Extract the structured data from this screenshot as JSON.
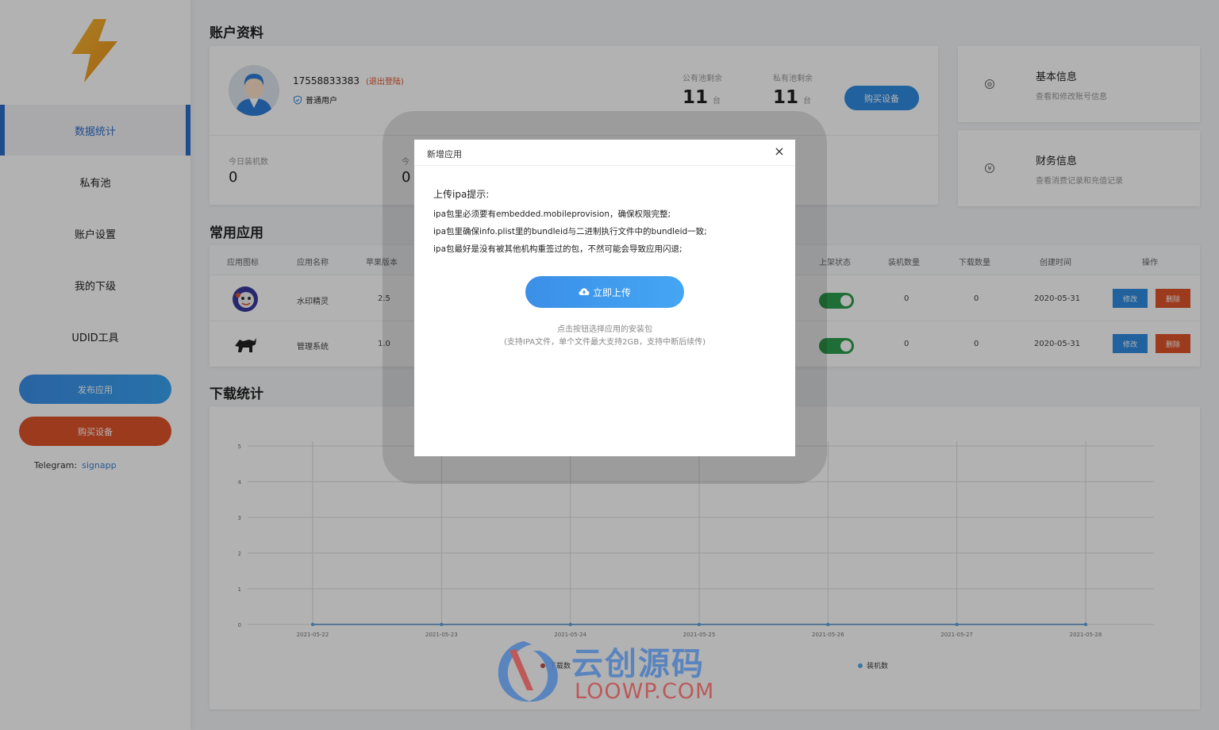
{
  "sidebar": {
    "nav": [
      "数据统计",
      "私有池",
      "账户设置",
      "我的下级",
      "UDID工具"
    ],
    "publish_btn": "发布应用",
    "buy_btn": "购买设备",
    "telegram_label": "Telegram:",
    "telegram_link": "signapp"
  },
  "account": {
    "title": "账户资料",
    "phone": "17558833383",
    "logout": "(退出登陆)",
    "user_type": "普通用户",
    "public_pool_label": "公有池剩余",
    "public_pool_value": "11",
    "private_pool_label": "私有池剩余",
    "private_pool_value": "11",
    "unit": "台",
    "buy_btn": "购买设备",
    "today_installs_label": "今日装机数",
    "today_installs_value": "0",
    "stat2_label": "今",
    "stat2_value": "0"
  },
  "info_cards": [
    {
      "title": "基本信息",
      "desc": "查看和修改账号信息",
      "icon": "gear-icon"
    },
    {
      "title": "财务信息",
      "desc": "查看消费记录和充值记录",
      "icon": "yen-icon"
    }
  ],
  "apps": {
    "title": "常用应用",
    "headers": [
      "应用图标",
      "应用名称",
      "苹果版本",
      "上架状态",
      "装机数量",
      "下载数量",
      "创建时间",
      "操作"
    ],
    "rows": [
      {
        "name": "水印精灵",
        "version": "2.5",
        "installs": "0",
        "downloads": "0",
        "created": "2020-05-31",
        "edit": "修改",
        "delete": "删除"
      },
      {
        "name": "管理系统",
        "version": "1.0",
        "installs": "0",
        "downloads": "0",
        "created": "2020-05-31",
        "edit": "修改",
        "delete": "删除"
      }
    ]
  },
  "downloads": {
    "title": "下载统计"
  },
  "chart_data": {
    "type": "line",
    "x": [
      "2021-05-22",
      "2021-05-23",
      "2021-05-24",
      "2021-05-25",
      "2021-05-26",
      "2021-05-27",
      "2021-05-28"
    ],
    "series": [
      {
        "name": "下载数",
        "values": [
          0,
          0,
          0,
          0,
          0,
          0,
          0
        ],
        "color": "#c0504d"
      },
      {
        "name": "装机数",
        "values": [
          0,
          0,
          0,
          0,
          0,
          0,
          0
        ],
        "color": "#5aa9e6"
      }
    ],
    "yticks": [
      "0",
      "1",
      "2",
      "3",
      "4",
      "5"
    ],
    "ylim": [
      0,
      5
    ],
    "grid": true,
    "legend": "bottom"
  },
  "modal": {
    "title": "新增应用",
    "close": "×",
    "tip_title": "上传ipa提示:",
    "tips": [
      "ipa包里必须要有embedded.mobileprovision，确保权限完整;",
      "ipa包里确保info.plist里的bundleid与二进制执行文件中的bundleid一致;",
      "ipa包最好是没有被其他机构重签过的包，不然可能会导致应用闪退;"
    ],
    "upload_btn": "立即上传",
    "hint1": "点击按钮选择应用的安装包",
    "hint2": "(支持IPA文件，单个文件最大支持2GB，支持中断后续传)"
  },
  "watermark": {
    "cn": "云创源码",
    "en": "LOOWP.COM"
  }
}
